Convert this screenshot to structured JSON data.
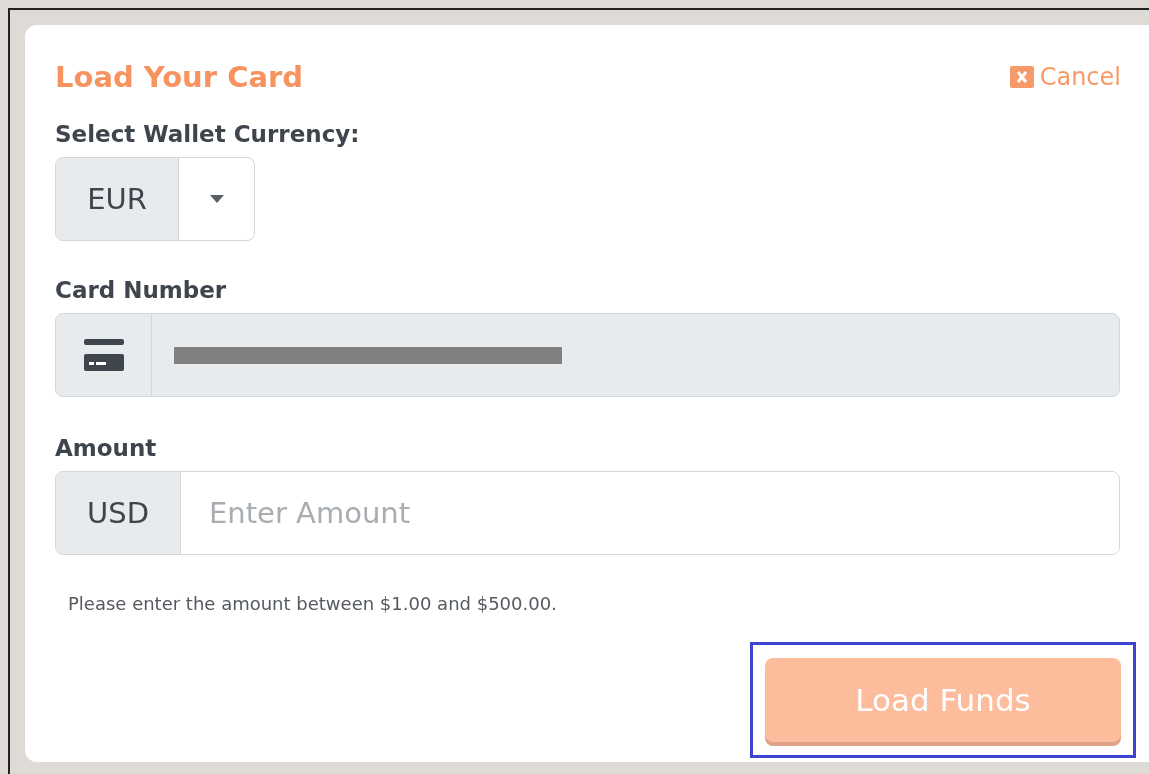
{
  "dialog": {
    "title": "Load Your Card",
    "cancel": "Cancel"
  },
  "currency": {
    "label": "Select Wallet Currency:",
    "value": "EUR"
  },
  "card_number": {
    "label": "Card Number",
    "redacted": true
  },
  "amount": {
    "label": "Amount",
    "prefix": "USD",
    "placeholder": "Enter Amount",
    "hint": "Please enter the amount between $1.00 and $500.00."
  },
  "submit": {
    "label": "Load Funds",
    "disabled": true,
    "highlighted": true
  }
}
